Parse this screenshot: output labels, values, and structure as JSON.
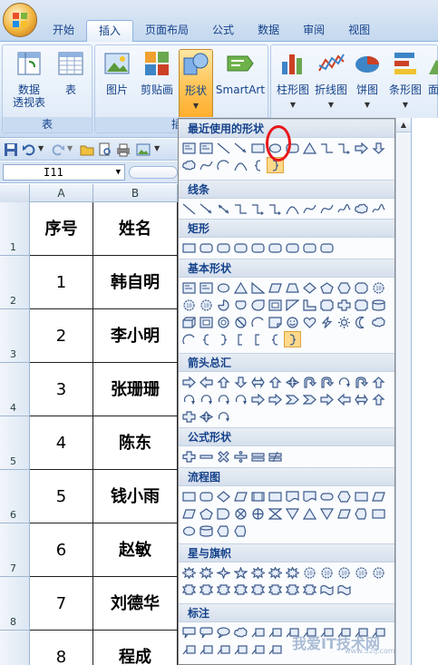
{
  "ribbon": {
    "tabs": [
      "开始",
      "插入",
      "页面布局",
      "公式",
      "数据",
      "审阅",
      "视图"
    ],
    "active_tab": "插入",
    "groups": {
      "table": {
        "label": "表",
        "pivot_label": "数据\n透视表",
        "pivot_line1": "数据",
        "pivot_line2": "透视表",
        "table_label": "表"
      },
      "illustrations": {
        "label": "插",
        "picture": "图片",
        "clipart": "剪贴画",
        "shapes": "形状",
        "smartart": "SmartArt"
      },
      "charts": {
        "column": "柱形图",
        "line": "折线图",
        "pie": "饼图",
        "bar": "条形图",
        "more": "面"
      }
    }
  },
  "namebox": {
    "value": "I11"
  },
  "columns": [
    "A",
    "B"
  ],
  "rows": [
    {
      "num": "1",
      "a": "序号",
      "b": "姓名"
    },
    {
      "num": "2",
      "a": "1",
      "b": "韩自明"
    },
    {
      "num": "3",
      "a": "2",
      "b": "李小明"
    },
    {
      "num": "4",
      "a": "3",
      "b": "张珊珊"
    },
    {
      "num": "5",
      "a": "4",
      "b": "陈东"
    },
    {
      "num": "6",
      "a": "5",
      "b": "钱小雨"
    },
    {
      "num": "7",
      "a": "6",
      "b": "赵敏"
    },
    {
      "num": "8",
      "a": "7",
      "b": "刘德华"
    },
    {
      "num": "",
      "a": "8",
      "b": "程成"
    }
  ],
  "gallery": {
    "sections": [
      "最近使用的形状",
      "线条",
      "矩形",
      "基本形状",
      "箭头总汇",
      "公式形状",
      "流程图",
      "星与旗帜",
      "标注"
    ]
  },
  "watermark": {
    "text": "我爱IT技术网",
    "url": "www.52ij.com"
  },
  "colors": {
    "accent": "#ffc65a",
    "highlight_circle": "#e8161a",
    "ribbon_text": "#15428b"
  }
}
